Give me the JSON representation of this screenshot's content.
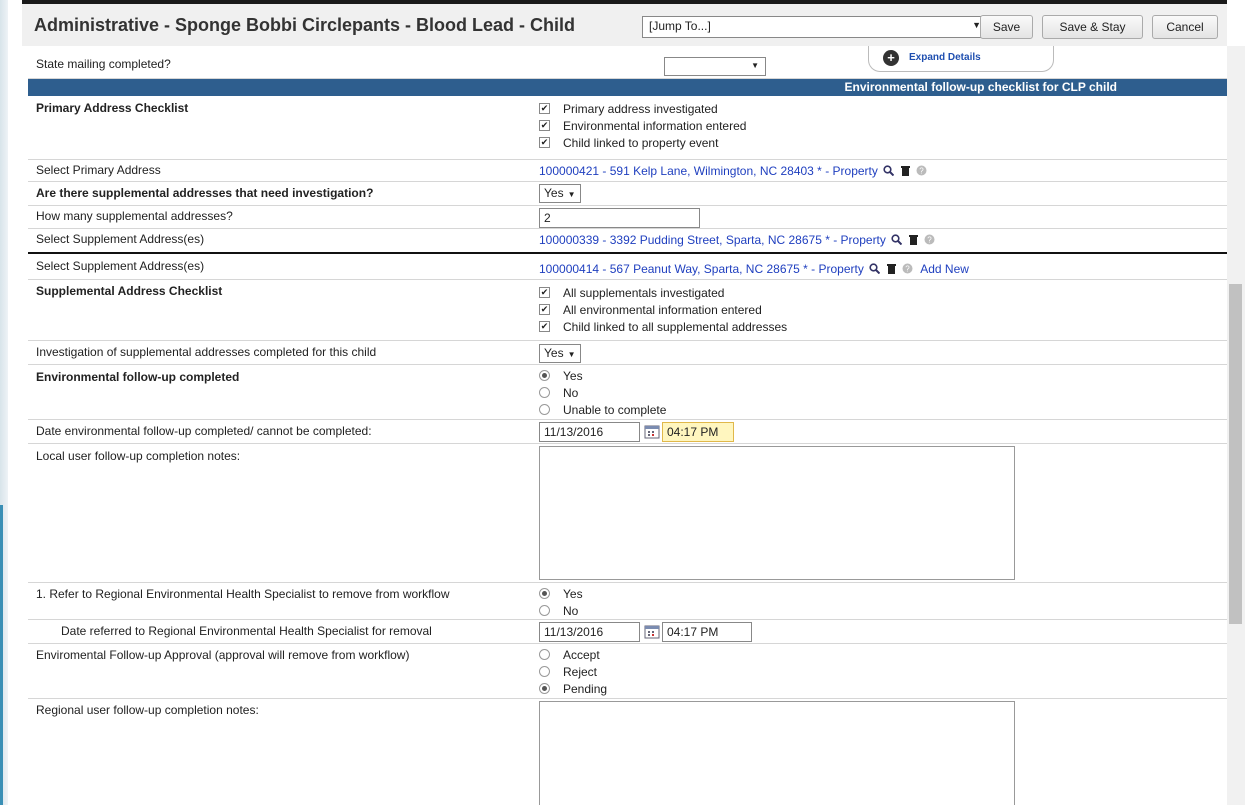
{
  "header": {
    "title": "Administrative - Sponge Bobbi Circlepants - Blood Lead - Child",
    "jump_to": "[Jump To...]",
    "save": "Save",
    "save_stay": "Save & Stay",
    "cancel": "Cancel",
    "expand_details": "Expand Details"
  },
  "state_mailing": {
    "label": "State mailing completed?",
    "value": ""
  },
  "banner": "Environmental follow-up checklist for CLP child",
  "primary_checklist": {
    "label": "Primary Address Checklist",
    "items": [
      "Primary address investigated",
      "Environmental information entered",
      "Child linked to property event"
    ]
  },
  "primary_address": {
    "label": "Select Primary Address",
    "value": "100000421 - 591 Kelp Lane, Wilmington, NC 28403 * - Property"
  },
  "supp_needed": {
    "label": "Are there supplemental addresses that need investigation?",
    "value": "Yes"
  },
  "supp_count": {
    "label": "How many supplemental addresses?",
    "value": "2"
  },
  "supp_address_1": {
    "label": "Select Supplement Address(es)",
    "value": "100000339 - 3392 Pudding Street, Sparta, NC 28675 * - Property"
  },
  "supp_address_2": {
    "label": "Select Supplement Address(es)",
    "value": "100000414 - 567 Peanut Way, Sparta, NC 28675 * - Property",
    "add_new": "Add New"
  },
  "supp_checklist": {
    "label": "Supplemental Address Checklist",
    "items": [
      "All supplementals investigated",
      "All environmental information entered",
      "Child linked to all supplemental addresses"
    ]
  },
  "supp_investigation": {
    "label": "Investigation of supplemental addresses completed for this child",
    "value": "Yes"
  },
  "env_followup": {
    "label": "Environmental follow-up completed",
    "options": [
      "Yes",
      "No",
      "Unable to complete"
    ],
    "selected": "Yes"
  },
  "env_date": {
    "label": "Date environmental follow-up completed/ cannot be completed:",
    "date": "11/13/2016",
    "time": "04:17 PM"
  },
  "local_notes": {
    "label": "Local user follow-up completion notes:",
    "value": ""
  },
  "refer": {
    "label": "1. Refer to Regional Environmental Health Specialist to remove from workflow",
    "options": [
      "Yes",
      "No"
    ],
    "selected": "Yes"
  },
  "refer_date": {
    "label": "Date referred to Regional Environmental Health Specialist for removal",
    "date": "11/13/2016",
    "time": "04:17 PM"
  },
  "approval": {
    "label": "Enviromental Follow-up Approval (approval will remove from workflow)",
    "options": [
      "Accept",
      "Reject",
      "Pending"
    ],
    "selected": "Pending"
  },
  "regional_notes": {
    "label": "Regional user follow-up completion notes:",
    "value": ""
  }
}
